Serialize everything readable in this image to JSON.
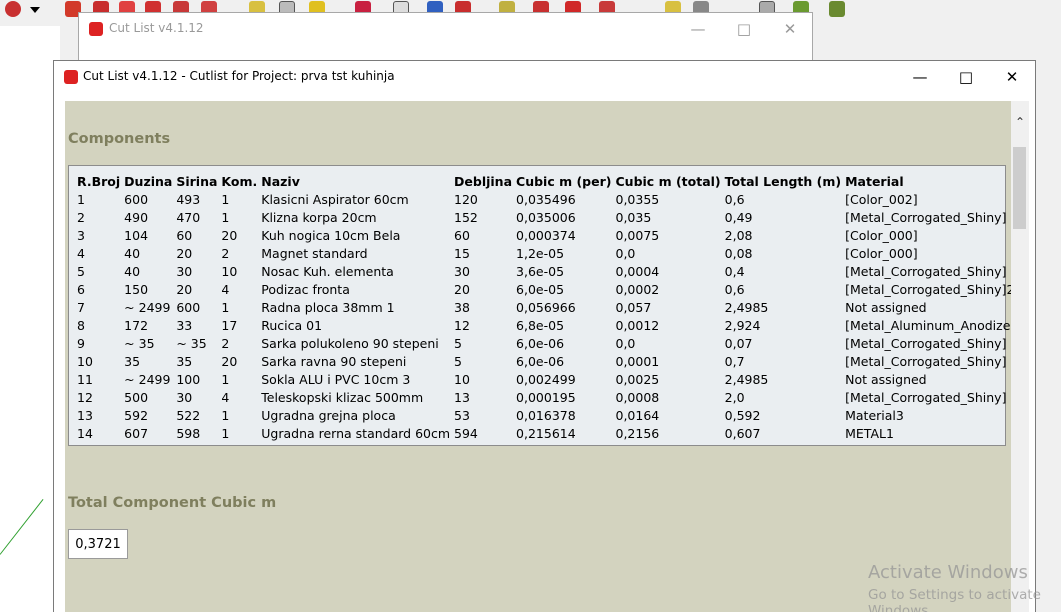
{
  "toolbar": {
    "icons": [
      "select-icon",
      "dropdown-arrow-icon",
      "push-pull-icon",
      "move-icon",
      "rotate-icon",
      "scale-icon",
      "offset-icon",
      "tape-measure-icon",
      "text-icon",
      "paint-bucket-icon",
      "orbit-icon",
      "pan-icon",
      "zoom-icon",
      "zoom-extents-icon",
      "section-icon",
      "camera-icon",
      "walk-icon",
      "look-around-icon",
      "position-camera-icon",
      "dimension-icon",
      "axes-icon"
    ]
  },
  "background_window": {
    "title": "Cut List v4.1.12"
  },
  "main_window": {
    "title": "Cut List v4.1.12 -  Cutlist for Project: prva tst kuhinja"
  },
  "components": {
    "heading": "Components",
    "columns": [
      "R.Broj",
      "Duzina",
      "Sirina",
      "Kom.",
      "Naziv",
      "Debljina",
      "Cubic m (per)",
      "Cubic m (total)",
      "Total Length (m)",
      "Material"
    ],
    "rows": [
      [
        "1",
        "600",
        "493",
        "1",
        "Klasicni Aspirator 60cm",
        "120",
        "0,035496",
        "0,0355",
        "0,6",
        "[Color_002]"
      ],
      [
        "2",
        "490",
        "470",
        "1",
        "Klizna korpa 20cm",
        "152",
        "0,035006",
        "0,035",
        "0,49",
        "[Metal_Corrogated_Shiny]"
      ],
      [
        "3",
        "104",
        "60",
        "20",
        "Kuh nogica 10cm Bela",
        "60",
        "0,000374",
        "0,0075",
        "2,08",
        "[Color_000]"
      ],
      [
        "4",
        "40",
        "20",
        "2",
        "Magnet standard",
        "15",
        "1,2e-05",
        "0,0",
        "0,08",
        "[Color_000]"
      ],
      [
        "5",
        "40",
        "30",
        "10",
        "Nosac Kuh. elementa",
        "30",
        "3,6e-05",
        "0,0004",
        "0,4",
        "[Metal_Corrogated_Shiny]"
      ],
      [
        "6",
        "150",
        "20",
        "4",
        "Podizac fronta",
        "20",
        "6,0e-05",
        "0,0002",
        "0,6",
        "[Metal_Corrogated_Shiny]2"
      ],
      [
        "7",
        "~ 2499",
        "600",
        "1",
        "Radna ploca 38mm 1",
        "38",
        "0,056966",
        "0,057",
        "2,4985",
        "Not assigned"
      ],
      [
        "8",
        "172",
        "33",
        "17",
        "Rucica 01",
        "12",
        "6,8e-05",
        "0,0012",
        "2,924",
        "[Metal_Aluminum_Anodized]"
      ],
      [
        "9",
        "~ 35",
        "~ 35",
        "2",
        "Sarka polukoleno 90 stepeni",
        "5",
        "6,0e-06",
        "0,0",
        "0,07",
        "[Metal_Corrogated_Shiny]"
      ],
      [
        "10",
        "35",
        "35",
        "20",
        "Sarka ravna 90 stepeni",
        "5",
        "6,0e-06",
        "0,0001",
        "0,7",
        "[Metal_Corrogated_Shiny]"
      ],
      [
        "11",
        "~ 2499",
        "100",
        "1",
        "Sokla ALU i PVC 10cm 3",
        "10",
        "0,002499",
        "0,0025",
        "2,4985",
        "Not assigned"
      ],
      [
        "12",
        "500",
        "30",
        "4",
        "Teleskopski klizac 500mm",
        "13",
        "0,000195",
        "0,0008",
        "2,0",
        "[Metal_Corrogated_Shiny]"
      ],
      [
        "13",
        "592",
        "522",
        "1",
        "Ugradna grejna ploca",
        "53",
        "0,016378",
        "0,0164",
        "0,592",
        "Material3"
      ],
      [
        "14",
        "607",
        "598",
        "1",
        "Ugradna rerna standard 60cm",
        "594",
        "0,215614",
        "0,2156",
        "0,607",
        "METAL1"
      ]
    ]
  },
  "total": {
    "heading": "Total Component Cubic m",
    "value": "0,3721"
  },
  "watermark": {
    "line1": "Activate Windows",
    "line2": "Go to Settings to activate Windows."
  },
  "colors": {
    "content_bg": "#d3d3bf",
    "heading": "#7f7f5e",
    "table_bg": "#eaeef1"
  }
}
